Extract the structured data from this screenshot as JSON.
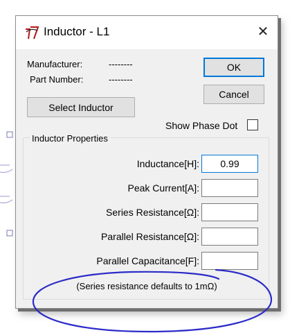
{
  "window": {
    "title": "Inductor - L1",
    "close_glyph": "✕",
    "icon": "ltspice-app-icon"
  },
  "info": {
    "manufacturer_label": "Manufacturer:",
    "manufacturer_value": "--------",
    "part_number_label": "Part Number:",
    "part_number_value": "--------"
  },
  "buttons": {
    "ok": "OK",
    "cancel": "Cancel",
    "select_inductor": "Select Inductor"
  },
  "show_phase_dot": {
    "label": "Show Phase Dot",
    "checked": false
  },
  "properties": {
    "group_title": "Inductor Properties",
    "fields": [
      {
        "label": "Inductance[H]:",
        "value": "0.99"
      },
      {
        "label": "Peak Current[A]:",
        "value": ""
      },
      {
        "label": "Series Resistance[Ω]:",
        "value": ""
      },
      {
        "label": "Parallel Resistance[Ω]:",
        "value": ""
      },
      {
        "label": "Parallel Capacitance[F]:",
        "value": ""
      }
    ]
  },
  "note": "(Series resistance defaults to 1mΩ)",
  "colors": {
    "annotation_ink": "#2b2bc8",
    "focus_border": "#0078d7"
  }
}
